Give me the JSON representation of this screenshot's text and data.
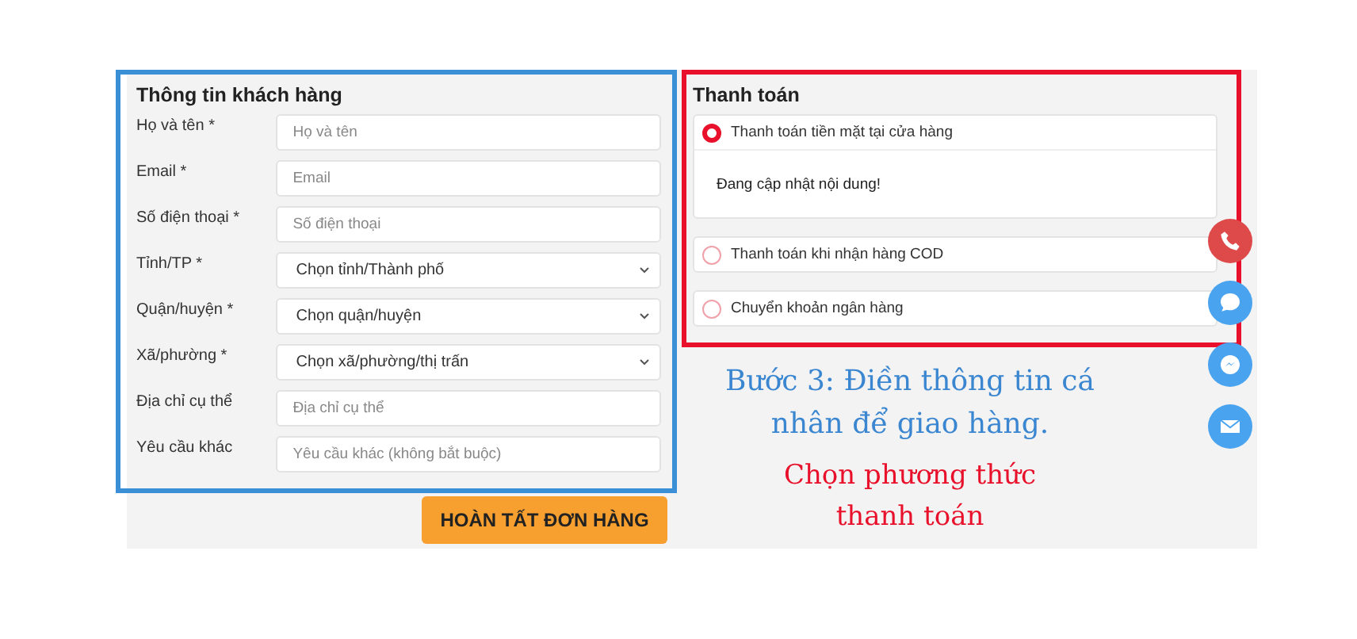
{
  "customer_form": {
    "title": "Thông tin khách hàng",
    "fields": [
      {
        "label": "Họ và tên *",
        "placeholder": "Họ và tên",
        "kind": "text"
      },
      {
        "label": "Email *",
        "placeholder": "Email",
        "kind": "text"
      },
      {
        "label": "Số điện thoại *",
        "placeholder": "Số điện thoại",
        "kind": "text"
      },
      {
        "label": "Tỉnh/TP *",
        "value": "Chọn tỉnh/Thành phố",
        "kind": "select"
      },
      {
        "label": "Quận/huyện *",
        "value": "Chọn quận/huyện",
        "kind": "select"
      },
      {
        "label": "Xã/phường *",
        "value": "Chọn xã/phường/thị trấn",
        "kind": "select"
      },
      {
        "label": "Địa chỉ cụ thể",
        "placeholder": "Địa chỉ cụ thể",
        "kind": "text"
      },
      {
        "label": "Yêu cầu khác",
        "placeholder": "Yêu cầu khác (không bắt buộc)",
        "kind": "text"
      }
    ]
  },
  "submit_button": "HOÀN TẤT ĐƠN HÀNG",
  "payment": {
    "title": "Thanh toán",
    "options": [
      {
        "label": "Thanh toán tiền mặt tại cửa hàng",
        "selected": true,
        "note": "Đang cập nhật nội dung!"
      },
      {
        "label": "Thanh toán khi nhận hàng COD",
        "selected": false
      },
      {
        "label": "Chuyển khoản ngân hàng",
        "selected": false
      }
    ]
  },
  "caption": {
    "step": "Bước 3: Điền thông tin cá nhân để giao hàng.",
    "hint": "Chọn phương thức thanh toán"
  }
}
